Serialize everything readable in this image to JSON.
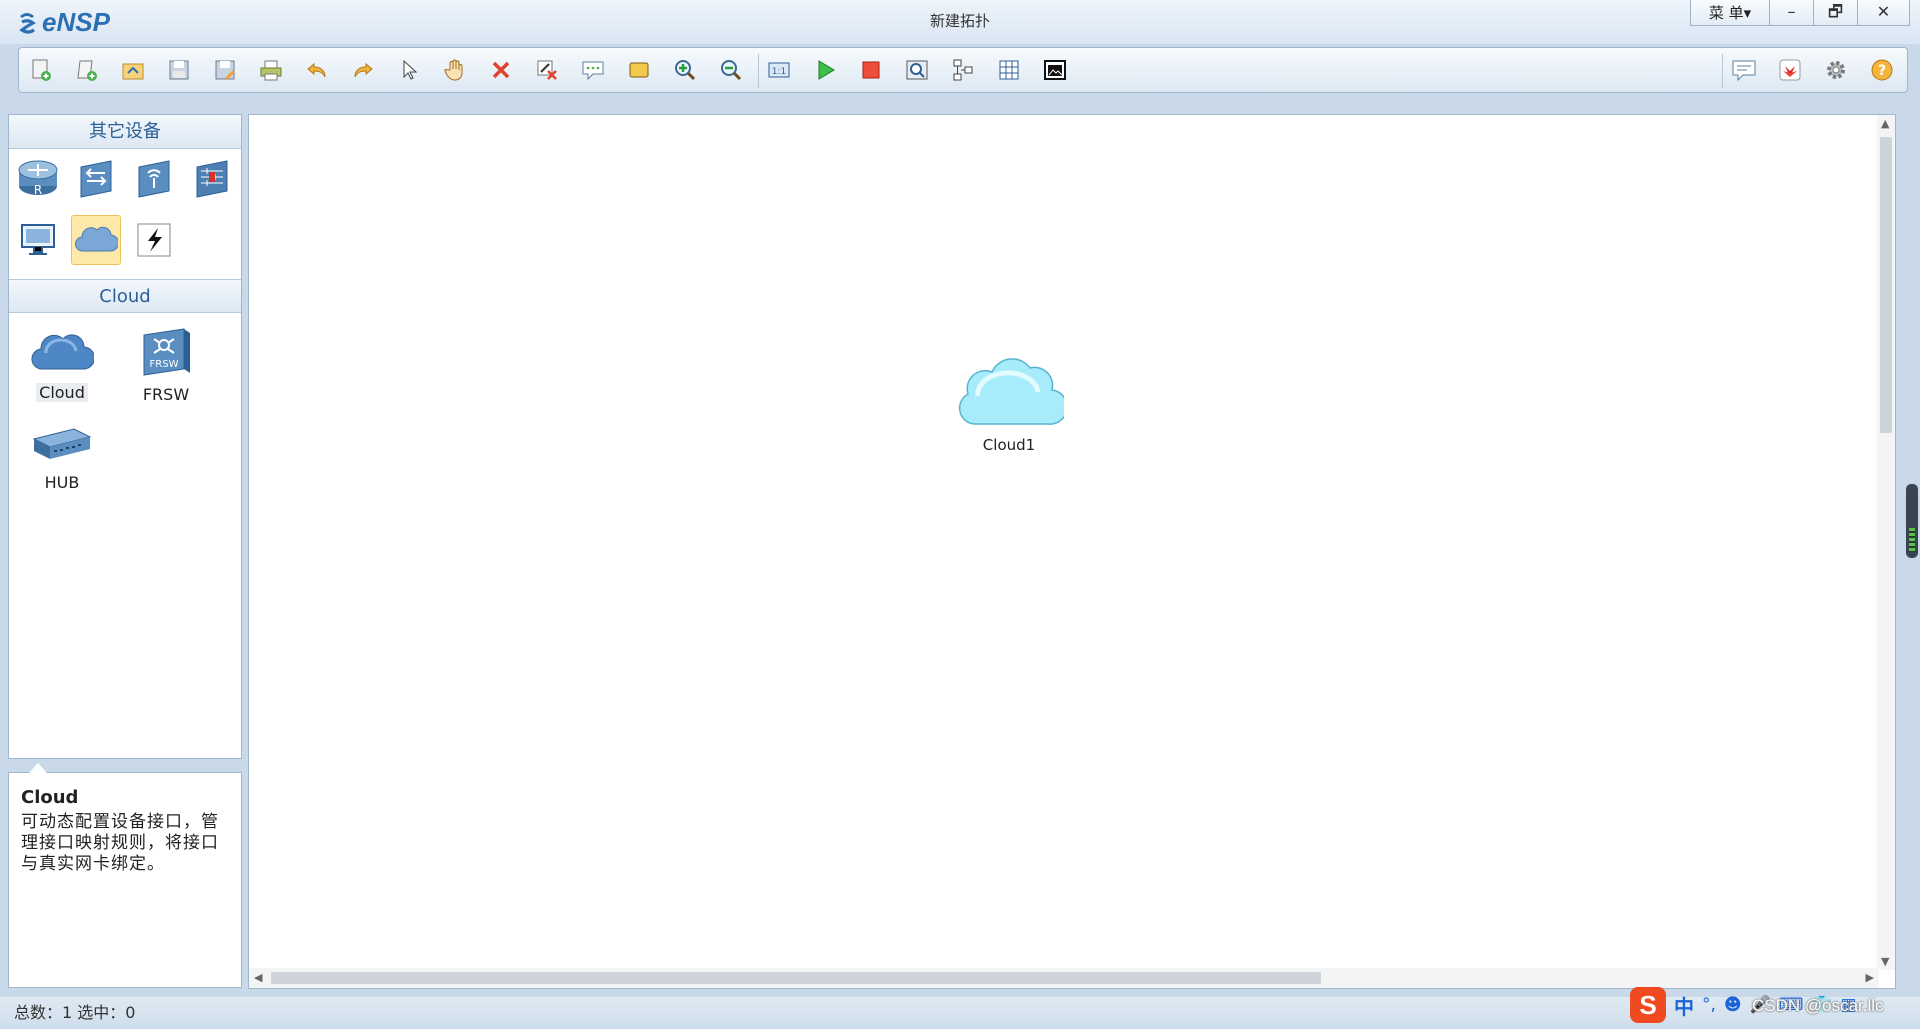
{
  "app": {
    "name": "eNSP",
    "window_title": "新建拓扑",
    "menu_label": "菜 单▾"
  },
  "window_controls": {
    "minimize": "–",
    "restore": "🗗",
    "close": "✕"
  },
  "toolbar": {
    "icons": [
      "new-topology-icon",
      "new-lab-icon",
      "open-icon",
      "save-icon",
      "save-as-icon",
      "print-icon",
      "undo-icon",
      "redo-icon",
      "select-icon",
      "pan-hand-icon",
      "delete-icon",
      "delete-link-icon",
      "text-note-icon",
      "rectangle-icon",
      "zoom-in-icon",
      "zoom-out-icon",
      "fit-view-icon",
      "start-device-icon",
      "stop-device-icon",
      "capture-icon",
      "topology-icon",
      "grid-icon",
      "screenshot-icon"
    ],
    "right_icons": [
      "chat-icon",
      "huawei-icon",
      "settings-icon",
      "help-icon"
    ]
  },
  "left_panel": {
    "category_header": "其它设备",
    "categories": [
      "router-icon",
      "switch-icon",
      "wireless-icon",
      "firewall-icon",
      "pc-icon",
      "cloud-icon",
      "link-icon"
    ],
    "selected_category": "cloud-icon",
    "device_header": "Cloud",
    "devices": [
      {
        "label": "Cloud",
        "icon": "cloud-icon"
      },
      {
        "label": "FRSW",
        "icon": "frsw-icon"
      },
      {
        "label": "HUB",
        "icon": "hub-icon"
      }
    ]
  },
  "description": {
    "title": "Cloud",
    "text": "可动态配置设备接口，管理接口映射规则，将接口与真实网卡绑定。"
  },
  "canvas": {
    "nodes": [
      {
        "label": "Cloud1",
        "icon": "cloud-icon"
      }
    ]
  },
  "status": {
    "text": "总数：1  选中：0"
  },
  "ime": {
    "zh": "中",
    "watermark": "CSDN @oscar.llc"
  },
  "colors": {
    "accent": "#2c6fb3",
    "cloud_fill": "#8fe3f5",
    "selection": "#fde9a8"
  }
}
